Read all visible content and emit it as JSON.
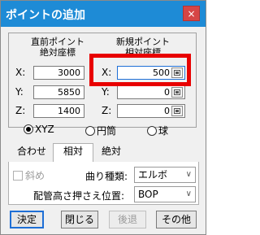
{
  "window": {
    "title": "ポイントの追加",
    "close_glyph": "×"
  },
  "coords": {
    "prev_header_line1": "直前ポイント",
    "prev_header_line2": "絶対座標",
    "new_header_line1": "新規ポイント",
    "new_header_line2": "相対座標",
    "x_label": "X:",
    "y_label": "Y:",
    "z_label": "Z:",
    "prev_x": "3000",
    "prev_y": "5850",
    "prev_z": "1400",
    "new_x": "500",
    "new_y": "0",
    "new_z": "0"
  },
  "coordinate_system": {
    "options": [
      "XYZ",
      "円筒",
      "球"
    ],
    "selected": "XYZ"
  },
  "tabs": [
    {
      "label": "合わせ",
      "active": false
    },
    {
      "label": "相対",
      "active": true
    },
    {
      "label": "絶対",
      "active": false
    }
  ],
  "options": {
    "diagonal_label": "斜め",
    "bend_type_label": "曲り種類:",
    "bend_type_value": "エルボ",
    "pipe_height_label": "配管高さ押さえ位置:",
    "pipe_height_value": "BOP"
  },
  "buttons": {
    "ok": "決定",
    "close": "閉じる",
    "back": "後退",
    "other": "その他"
  },
  "colors": {
    "titlebar": "#1e8bd6",
    "highlight": "#e80000",
    "close_button": "#d64545"
  }
}
